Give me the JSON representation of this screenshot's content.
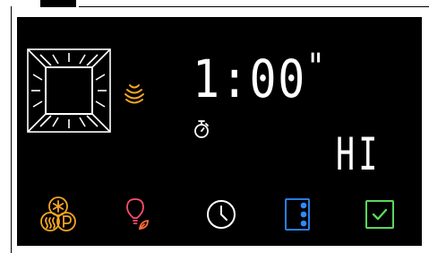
{
  "display": {
    "time_main": "1:00",
    "time_suffix": "\"",
    "power_level": "HI"
  },
  "icons": {
    "oven_view": "oven-interior-icon",
    "heat_waves": "microwave-waves-icon",
    "timer": "stopwatch-icon",
    "presets": "snowflake-steam-pizza-icon",
    "light": "light-bulb-icon",
    "clock": "clock-icon",
    "options": "menu-dots-icon",
    "confirm": "checkbox-icon"
  },
  "colors": {
    "background": "#000000",
    "digits": "#ffffff",
    "waves": "#f5a623",
    "presets": "#f5a623",
    "light": "#ff4d6d",
    "light_leaf": "#ff6a33",
    "clock": "#ffffff",
    "options": "#2f8cff",
    "confirm": "#5cd65c"
  }
}
